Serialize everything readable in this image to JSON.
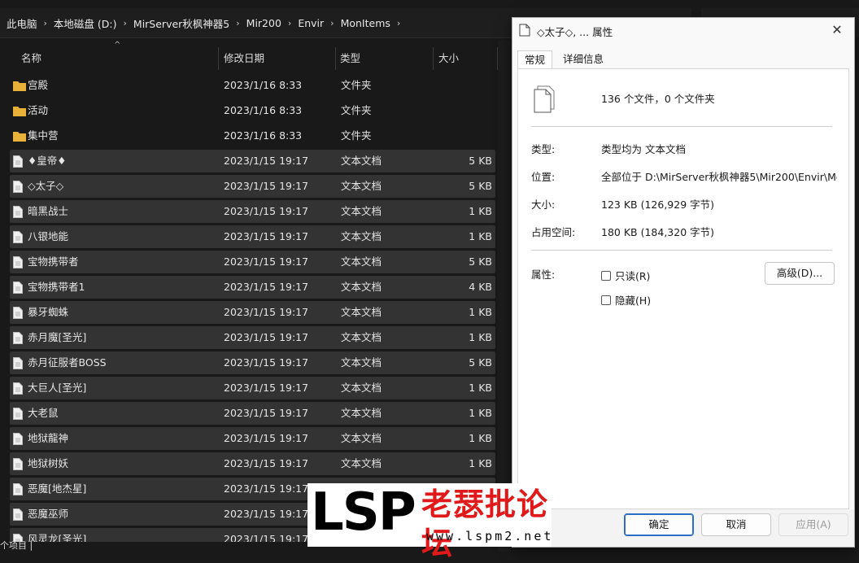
{
  "explorer": {
    "breadcrumb": [
      "此电脑",
      "本地磁盘 (D:)",
      "MirServer秋枫神器5",
      "Mir200",
      "Envir",
      "MonItems"
    ],
    "columns": {
      "name": "名称",
      "date": "修改日期",
      "type": "类型",
      "size": "大小"
    },
    "rows": [
      {
        "name": "宫殿",
        "date": "2023/1/16 8:33",
        "type": "文件夹",
        "size": "",
        "kind": "folder",
        "selected": false
      },
      {
        "name": "活动",
        "date": "2023/1/16 8:33",
        "type": "文件夹",
        "size": "",
        "kind": "folder",
        "selected": false
      },
      {
        "name": "集中营",
        "date": "2023/1/16 8:33",
        "type": "文件夹",
        "size": "",
        "kind": "folder",
        "selected": false
      },
      {
        "name": "♦皇帝♦",
        "date": "2023/1/15 19:17",
        "type": "文本文档",
        "size": "5 KB",
        "kind": "file",
        "selected": true
      },
      {
        "name": "◇太子◇",
        "date": "2023/1/15 19:17",
        "type": "文本文档",
        "size": "5 KB",
        "kind": "file",
        "selected": true
      },
      {
        "name": "暗黑战士",
        "date": "2023/1/15 19:17",
        "type": "文本文档",
        "size": "1 KB",
        "kind": "file",
        "selected": true
      },
      {
        "name": "八银地能",
        "date": "2023/1/15 19:17",
        "type": "文本文档",
        "size": "1 KB",
        "kind": "file",
        "selected": true
      },
      {
        "name": "宝物携带者",
        "date": "2023/1/15 19:17",
        "type": "文本文档",
        "size": "5 KB",
        "kind": "file",
        "selected": true
      },
      {
        "name": "宝物携带者1",
        "date": "2023/1/15 19:17",
        "type": "文本文档",
        "size": "4 KB",
        "kind": "file",
        "selected": true
      },
      {
        "name": "暴牙蜘蛛",
        "date": "2023/1/15 19:17",
        "type": "文本文档",
        "size": "1 KB",
        "kind": "file",
        "selected": true
      },
      {
        "name": "赤月魔[圣光]",
        "date": "2023/1/15 19:17",
        "type": "文本文档",
        "size": "1 KB",
        "kind": "file",
        "selected": true
      },
      {
        "name": "赤月征服者BOSS",
        "date": "2023/1/15 19:17",
        "type": "文本文档",
        "size": "5 KB",
        "kind": "file",
        "selected": true
      },
      {
        "name": "大巨人[圣光]",
        "date": "2023/1/15 19:17",
        "type": "文本文档",
        "size": "1 KB",
        "kind": "file",
        "selected": true
      },
      {
        "name": "大老鼠",
        "date": "2023/1/15 19:17",
        "type": "文本文档",
        "size": "1 KB",
        "kind": "file",
        "selected": true
      },
      {
        "name": "地狱龍神",
        "date": "2023/1/15 19:17",
        "type": "文本文档",
        "size": "1 KB",
        "kind": "file",
        "selected": true
      },
      {
        "name": "地狱树妖",
        "date": "2023/1/15 19:17",
        "type": "文本文档",
        "size": "1 KB",
        "kind": "file",
        "selected": true
      },
      {
        "name": "恶魔[地杰星]",
        "date": "2023/1/15 19:17",
        "type": "文本文档",
        "size": "",
        "kind": "file",
        "selected": true
      },
      {
        "name": "恶魔巫师",
        "date": "2023/1/15 19:17",
        "type": "文本文档",
        "size": "",
        "kind": "file",
        "selected": true
      },
      {
        "name": "风灵龙[圣光]",
        "date": "2023/1/15 19:17",
        "type": "",
        "size": "",
        "kind": "file",
        "selected": true
      }
    ],
    "status": "个项目 |"
  },
  "dialog": {
    "title": "◇太子◇, ... 属性",
    "close_glyph": "✕",
    "tabs": [
      "常规",
      "详细信息"
    ],
    "summary": "136 个文件，0 个文件夹",
    "props": [
      {
        "label": "类型:",
        "value": "类型均为 文本文档"
      },
      {
        "label": "位置:",
        "value": "全部位于 D:\\MirServer秋枫神器5\\Mir200\\Envir\\Mo"
      },
      {
        "label": "大小:",
        "value": "123 KB (126,929 字节)"
      },
      {
        "label": "占用空间:",
        "value": "180 KB (184,320 字节)"
      }
    ],
    "attributes_label": "属性:",
    "readonly_label": "只读(R)",
    "hidden_label": "隐藏(H)",
    "advanced_button": "高级(D)...",
    "ok_button": "确定",
    "cancel_button": "取消",
    "apply_button": "应用(A)"
  },
  "watermark": {
    "logo": "LSP",
    "site_name": "老瑟批论坛",
    "url": "www.lspm2.net"
  },
  "colors": {
    "explorer_bg": "#191919",
    "selected_row": "#333333",
    "folder": "#e8b23a",
    "dialog_bg": "#f9f9f9",
    "primary_border": "#2c6ec2",
    "watermark_red": "#e01a1a"
  }
}
